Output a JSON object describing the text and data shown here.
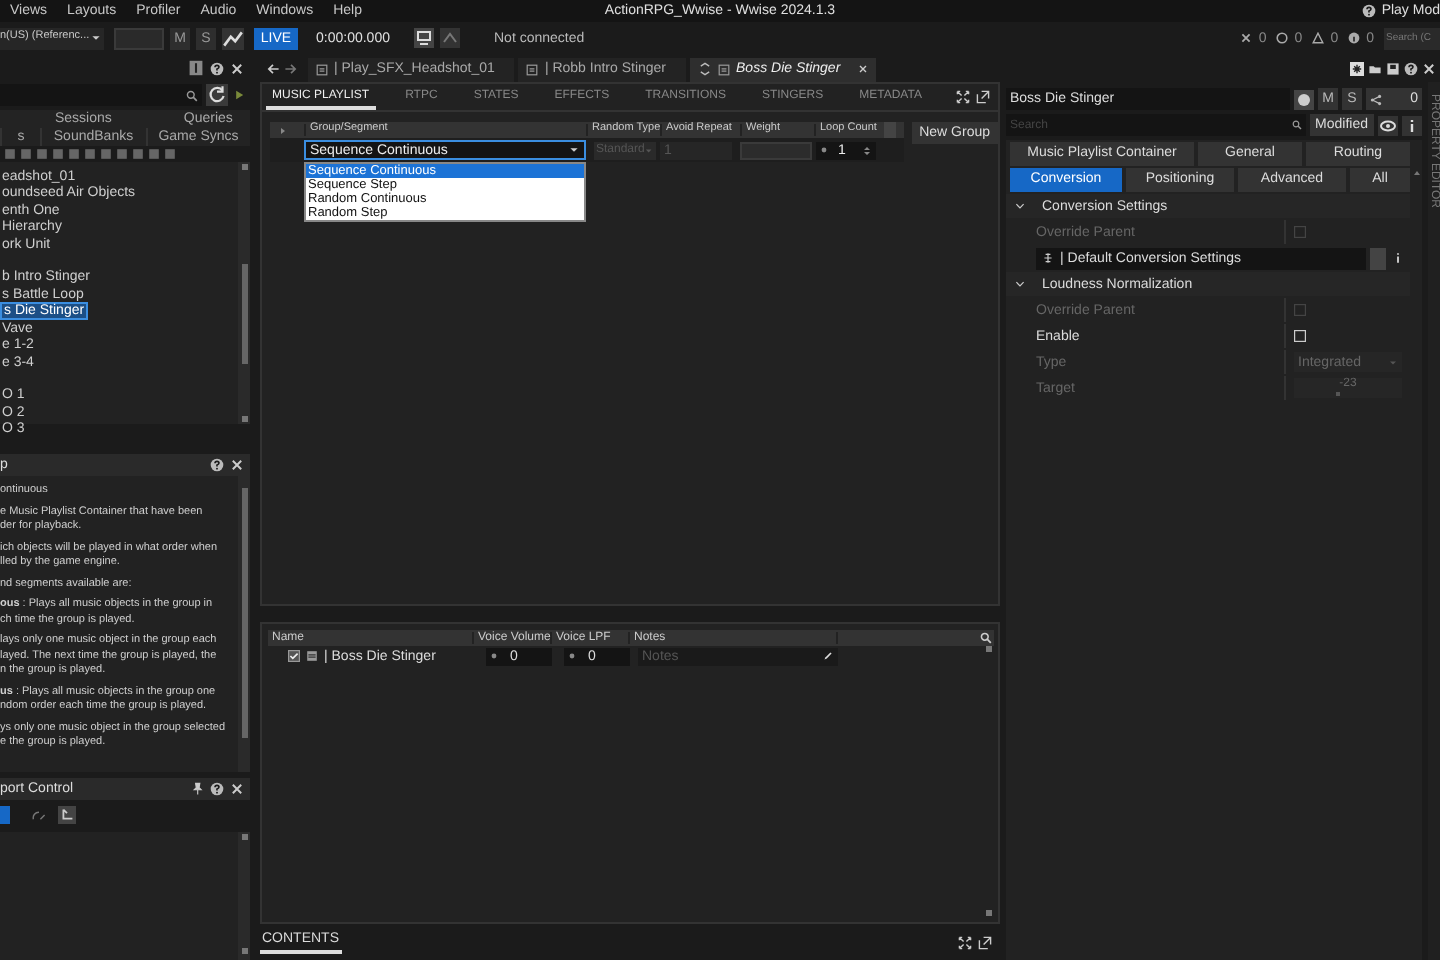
{
  "menu": [
    "Views",
    "Layouts",
    "Profiler",
    "Audio",
    "Windows",
    "Help"
  ],
  "app_title": "ActionRPG_Wwise - Wwise 2024.1.3",
  "play_mode": "Play Mod",
  "toolbar": {
    "language": "n(US) (Referenc...",
    "mute": "M",
    "solo": "S",
    "live": "LIVE",
    "live_on": true,
    "time": "0:00:00.000",
    "connection": "Not connected",
    "counts": [
      "0",
      "0",
      "0",
      "0"
    ],
    "search_placeholder": "Search (C"
  },
  "left": {
    "tabs_row1": [
      {
        "label": "Sessions"
      },
      {
        "label": "Queries"
      }
    ],
    "tabs_row2": [
      {
        "label": "s"
      },
      {
        "label": "SoundBanks"
      },
      {
        "label": "Game Syncs"
      }
    ],
    "tree_groups": [
      [
        {
          "label": "eadshot_01",
          "selected": false
        },
        {
          "label": "oundseed Air Objects",
          "selected": false
        },
        {
          "label": "enth One",
          "selected": false
        },
        {
          "label": "Hierarchy",
          "selected": false
        },
        {
          "label": "ork Unit",
          "selected": false
        }
      ],
      [
        {
          "label": "b Intro Stinger",
          "selected": false
        },
        {
          "label": "s Battle Loop",
          "selected": false
        },
        {
          "label": "s Die Stinger",
          "selected": true
        },
        {
          "label": "Vave",
          "selected": false
        },
        {
          "label": "e 1-2",
          "selected": false
        },
        {
          "label": "e 3-4",
          "selected": false
        }
      ],
      [
        {
          "label": "O 1",
          "selected": false
        },
        {
          "label": "O 2",
          "selected": false
        },
        {
          "label": "O 3",
          "selected": false
        }
      ]
    ]
  },
  "help": {
    "title": "p",
    "paragraphs": [
      "ontinuous",
      "e Music Playlist Container that have been\nder for playback.",
      "ich objects will be played in what order when\nlled by the game engine.",
      "nd segments available are:",
      "**ous** : Plays all music objects in the group in\nch time the group is played.",
      "lays only one music object in the group each\nlayed. The next time the group is played, the\nn the group is played.",
      "**us** : Plays all music objects in the group one\nndom order each time the group is played.",
      "ys only one music object in the group selected\ne the group is played."
    ]
  },
  "transport": {
    "title": "port Control"
  },
  "doc_tabs": [
    {
      "label": "| Play_SFX_Headshot_01",
      "selected": false
    },
    {
      "label": "| Robb Intro Stinger",
      "selected": false
    },
    {
      "label": "Boss Die Stinger",
      "selected": true
    }
  ],
  "editor": {
    "tabs": [
      {
        "label": "MUSIC PLAYLIST",
        "selected": true
      },
      {
        "label": "RTPC",
        "selected": false
      },
      {
        "label": "STATES",
        "selected": false
      },
      {
        "label": "EFFECTS",
        "selected": false
      },
      {
        "label": "TRANSITIONS",
        "selected": false
      },
      {
        "label": "STINGERS",
        "selected": false
      },
      {
        "label": "METADATA",
        "selected": false
      }
    ],
    "columns": [
      "Group/Segment",
      "Random Type",
      "Avoid Repeat",
      "Weight",
      "Loop Count"
    ],
    "row": {
      "group": "Sequence Continuous",
      "random_type": "Standard",
      "avoid_repeat": "1",
      "loop_count": "1"
    },
    "dropdown_options": [
      {
        "label": "Sequence Continuous",
        "selected": true
      },
      {
        "label": "Sequence Step",
        "selected": false
      },
      {
        "label": "Random Continuous",
        "selected": false
      },
      {
        "label": "Random Step",
        "selected": false
      }
    ],
    "new_group": "New Group"
  },
  "contents": {
    "columns": [
      "Name",
      "Voice Volume",
      "Voice LPF",
      "Notes"
    ],
    "rows": [
      {
        "name": "| Boss Die Stinger",
        "checked": true,
        "voice_volume": "0",
        "voice_lpf": "0",
        "notes_placeholder": "Notes"
      }
    ],
    "tab": "CONTENTS"
  },
  "property": {
    "name": "Boss Die Stinger",
    "mute": "M",
    "solo": "S",
    "count": "0",
    "search_placeholder": "Search",
    "modified": "Modified",
    "tabs_row1": [
      {
        "label": "Music Playlist Container",
        "selected": false
      },
      {
        "label": "General",
        "selected": false
      },
      {
        "label": "Routing",
        "selected": false
      }
    ],
    "tabs_row2": [
      {
        "label": "Conversion",
        "selected": true
      },
      {
        "label": "Positioning",
        "selected": false
      },
      {
        "label": "Advanced",
        "selected": false
      },
      {
        "label": "All",
        "selected": false
      }
    ],
    "sections": [
      {
        "title": "Conversion Settings",
        "expanded": true,
        "rows": [
          {
            "kind": "checkbox",
            "label": "Override Parent",
            "checked": false,
            "disabled": true
          },
          {
            "kind": "reference",
            "value": "| Default Conversion Settings"
          }
        ]
      },
      {
        "title": "Loudness Normalization",
        "expanded": true,
        "rows": [
          {
            "kind": "checkbox",
            "label": "Override Parent",
            "checked": false,
            "disabled": true
          },
          {
            "kind": "checkbox",
            "label": "Enable",
            "checked": false,
            "disabled": false
          },
          {
            "kind": "select",
            "label": "Type",
            "value": "Integrated",
            "disabled": true
          },
          {
            "kind": "slider",
            "label": "Target",
            "value": "-23",
            "disabled": true
          }
        ]
      }
    ],
    "side_label": "PROPERTY EDITOR"
  }
}
